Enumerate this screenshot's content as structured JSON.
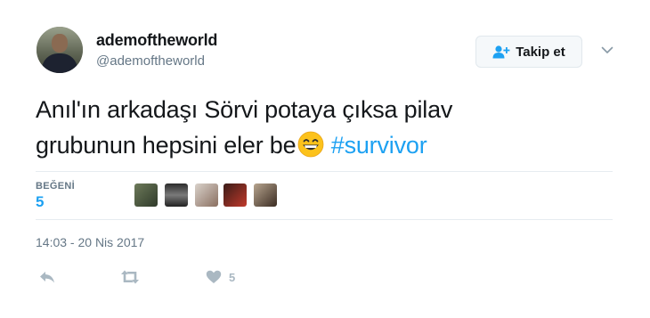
{
  "user": {
    "display_name": "ademoftheworld",
    "handle": "@ademoftheworld",
    "avatar_icon": "profile-photo"
  },
  "follow_button": {
    "label": "Takip et",
    "icon": "follow-person-plus-icon"
  },
  "menu_caret": {
    "icon": "chevron-down-icon"
  },
  "tweet": {
    "text_line1": "Anıl'ın arkadaşı Sörvi potaya çıksa pilav",
    "text_line2": "grubunun hepsini eler be",
    "emoji": "grinning-face-emoji",
    "hashtag": "#survivor"
  },
  "likes": {
    "label": "BEĞENİ",
    "count": "5",
    "liker_avatars": 5
  },
  "timestamp": "14:03 - 20 Nis 2017",
  "actions": {
    "reply": {
      "icon": "reply-icon"
    },
    "retweet": {
      "icon": "retweet-icon"
    },
    "like": {
      "icon": "heart-icon",
      "count": "5"
    }
  },
  "colors": {
    "accent": "#1da1f2",
    "text": "#14171a",
    "muted": "#657786",
    "action": "#aab8c2",
    "divider": "#e6ecf0"
  }
}
